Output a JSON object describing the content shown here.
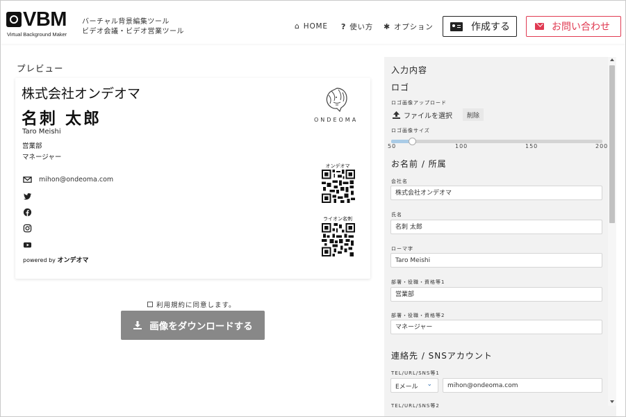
{
  "header": {
    "logo_text": "VBM",
    "logo_subtitle": "Virtual Background Maker",
    "tagline_line1": "バーチャル背景編集ツール",
    "tagline_line2": "ビデオ会議・ビデオ営業ツール",
    "nav": {
      "home": "HOME",
      "howto": "使い方",
      "options": "オプション"
    },
    "create_button": "作成する",
    "contact_button": "お問い合わせ"
  },
  "preview": {
    "title": "プレビュー",
    "card": {
      "company": "株式会社オンデオマ",
      "name": "名刺 太郎",
      "romaji": "Taro Meishi",
      "dept1": "営業部",
      "dept2": "マネージャー",
      "email": "mihon@ondeoma.com",
      "logo_text": "ONDEOMA",
      "qr1_label": "オンデオマ",
      "qr2_label": "ライオン名刺",
      "powered_prefix": "powered by",
      "powered_brand": "オンデオマ"
    },
    "agree_text": "利用規約に同意します。",
    "download_button": "画像をダウンロードする"
  },
  "form": {
    "section_title": "入力内容",
    "logo_section": "ロゴ",
    "logo_upload_label": "ロゴ画像アップロード",
    "file_select": "ファイルを選択",
    "delete": "削除",
    "logo_size_label": "ロゴ画像サイズ",
    "slider": {
      "min": 50,
      "max": 200,
      "value": 65,
      "ticks": [
        "50",
        "100",
        "150",
        "200"
      ]
    },
    "name_section": "お名前 / 所属",
    "company_label": "会社名",
    "company_value": "株式会社オンデオマ",
    "name_label": "氏名",
    "name_value": "名刺 太郎",
    "romaji_label": "ローマ字",
    "romaji_value": "Taro Meishi",
    "dept1_label": "部署・役職・資格等1",
    "dept1_value": "営業部",
    "dept2_label": "部署・役職・資格等2",
    "dept2_value": "マネージャー",
    "contact_section": "連絡先 / SNSアカウント",
    "tel1_label": "TEL/URL/SNS等1",
    "tel1_type": "Eメール",
    "tel1_value": "mihon@ondeoma.com",
    "tel2_label": "TEL/URL/SNS等2"
  },
  "colors": {
    "accent_red": "#e03a52",
    "download_gray": "#888888",
    "panel_bg": "#f2f2f2"
  }
}
